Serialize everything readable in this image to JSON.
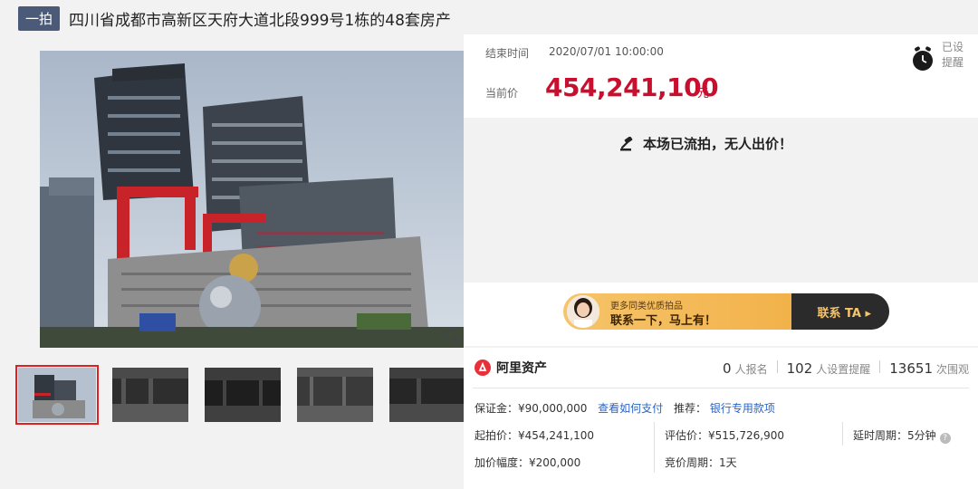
{
  "header": {
    "badge": "一拍",
    "title": "四川省成都市高新区天府大道北段999号1栋的48套房产"
  },
  "auction": {
    "end_label": "结束时间",
    "end_time": "2020/07/01 10:00:00",
    "price_label": "当前价",
    "price": "454,241,100",
    "price_unit": "元",
    "remind_line1": "已设",
    "remind_line2": "提醒",
    "status": "本场已流拍，无人出价！"
  },
  "ad": {
    "small": "更多同类优质拍品",
    "big": "联系一下，马上有！",
    "button": "联系 TA ▸"
  },
  "info": {
    "brand": "阿里资产",
    "stats": [
      {
        "num": "0",
        "label": "人报名"
      },
      {
        "num": "102",
        "label": "人设置提醒"
      },
      {
        "num": "13651",
        "label": "次围观"
      }
    ],
    "deposit": "保证金：¥90,000,000",
    "deposit_link": "查看如何支付",
    "recommend_label": "推荐：",
    "recommend_link": "银行专用款项",
    "start_price": "起拍价：¥454,241,100",
    "increment": "加价幅度：¥200,000",
    "eval_price": "评估价：¥515,726,900",
    "bid_cycle": "竞价周期：1天",
    "delay": "延时周期：5分钟",
    "help_glyph": "?"
  },
  "colors": {
    "price_red": "#c8102e",
    "badge_bg": "#4a5a78",
    "link_blue": "#2864c8",
    "ad_gold": "#f6c46a"
  }
}
